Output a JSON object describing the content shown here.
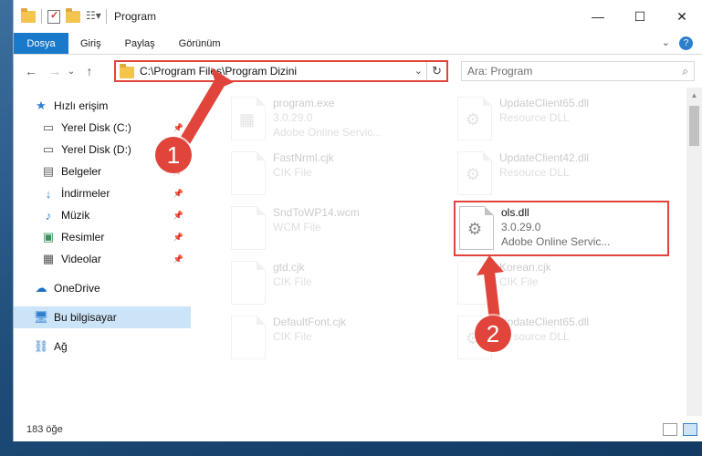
{
  "titlebar": {
    "title": "Program",
    "quick_access_icons": [
      "folder-icon",
      "properties-icon",
      "new-folder-icon",
      "customize-icon"
    ]
  },
  "window_controls": {
    "minimize": "—",
    "maximize": "☐",
    "close": "✕"
  },
  "ribbon": {
    "tabs": [
      "Dosya",
      "Giriş",
      "Paylaş",
      "Görünüm"
    ],
    "expand_glyph": "⌄",
    "help_glyph": "?"
  },
  "navigation": {
    "back": "←",
    "forward": "→",
    "recent": "⌄",
    "up": "↑",
    "address": "C:\\Program Files\\Program Dizini",
    "address_dropdown": "⌄",
    "refresh": "↻",
    "search_placeholder": "Ara: Program",
    "search_glyph": "⌕"
  },
  "sidebar": {
    "items": [
      {
        "label": "Hızlı erişim",
        "icon": "star-icon",
        "pinned": false
      },
      {
        "label": "Yerel Disk (C:)",
        "icon": "drive-icon",
        "pinned": true
      },
      {
        "label": "Yerel Disk (D:)",
        "icon": "drive-icon",
        "pinned": true
      },
      {
        "label": "Belgeler",
        "icon": "documents-icon",
        "pinned": true
      },
      {
        "label": "İndirmeler",
        "icon": "download-icon",
        "pinned": true
      },
      {
        "label": "Müzik",
        "icon": "music-icon",
        "pinned": true
      },
      {
        "label": "Resimler",
        "icon": "pictures-icon",
        "pinned": true
      },
      {
        "label": "Videolar",
        "icon": "videos-icon",
        "pinned": true
      },
      {
        "label": "OneDrive",
        "icon": "cloud-icon",
        "pinned": false
      },
      {
        "label": "Bu bilgisayar",
        "icon": "computer-icon",
        "pinned": false,
        "selected": true
      },
      {
        "label": "Ağ",
        "icon": "network-icon",
        "pinned": false
      }
    ],
    "pin_glyph": "📌"
  },
  "files": [
    {
      "name": "program.exe",
      "line2": "3.0.29.0",
      "line3": "Adobe Online Servic..."
    },
    {
      "name": "UpdateClient65.dll",
      "line2": "Resource DLL",
      "line3": ""
    },
    {
      "name": "FastNrml.cjk",
      "line2": "CIK File",
      "line3": ""
    },
    {
      "name": "UpdateClient42.dll",
      "line2": "Resource DLL",
      "line3": ""
    },
    {
      "name": "SndToWP14.wcm",
      "line2": "WCM File",
      "line3": ""
    },
    {
      "name": "ols.dll",
      "line2": "3.0.29.0",
      "line3": "Adobe Online Servic...",
      "highlighted": true
    },
    {
      "name": "gtd.cjk",
      "line2": "CIK File",
      "line3": ""
    },
    {
      "name": "Korean.cjk",
      "line2": "CIK File",
      "line3": ""
    },
    {
      "name": "DefaultFont.cjk",
      "line2": "CIK File",
      "line3": ""
    },
    {
      "name": "UpdateClient65.dll",
      "line2": "Resource DLL",
      "line3": ""
    }
  ],
  "status": {
    "item_count": "183 öğe"
  },
  "callouts": {
    "one": "1",
    "two": "2"
  },
  "colors": {
    "accent": "#1979ca",
    "callout": "#e0443a",
    "selected_bg": "#cce4f7"
  }
}
